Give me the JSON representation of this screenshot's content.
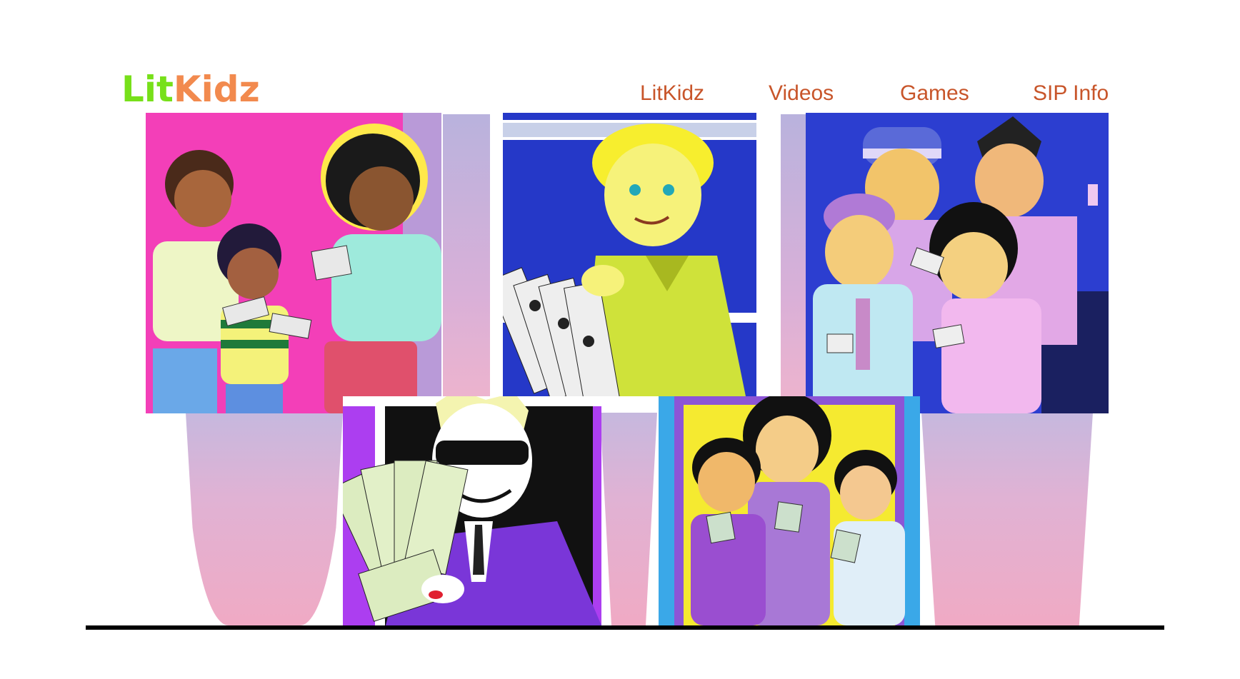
{
  "brand": {
    "part1": "Lit",
    "part2": "Kidz",
    "color_part1": "#77e01a",
    "color_part2": "#f28a4e"
  },
  "nav": {
    "items": [
      {
        "label": "LitKidz"
      },
      {
        "label": "Videos"
      },
      {
        "label": "Games"
      },
      {
        "label": "SIP Info"
      }
    ],
    "color": "#c8552a"
  },
  "gallery": {
    "images": [
      {
        "subject": "three children counting money on pink background"
      },
      {
        "subject": "blond boy holding stack of bills on blue background"
      },
      {
        "subject": "group of four children holding bills on blue background"
      },
      {
        "subject": "man in sunglasses fanning dollar bills on purple background"
      },
      {
        "subject": "three children holding bills on yellow background"
      }
    ]
  },
  "colors": {
    "curtain": "#e0b2d4",
    "floor_line": "#000000"
  }
}
